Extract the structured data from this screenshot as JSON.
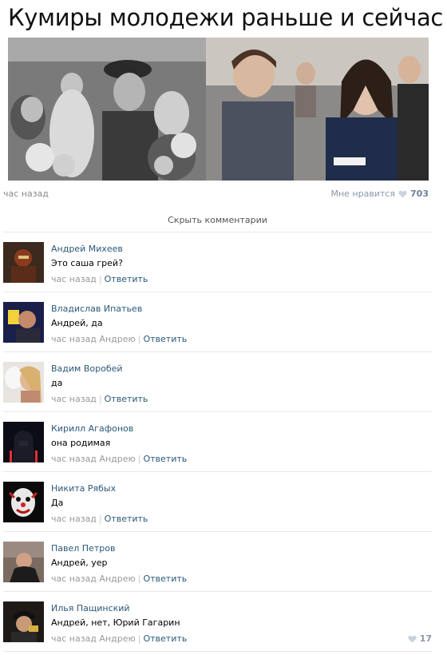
{
  "post": {
    "title": "Кумиры молодежи раньше и сейчас",
    "time": "час назад",
    "like_label": "Мне нравится",
    "like_count": "703"
  },
  "hide_comments_label": "Скрыть комментарии",
  "reply_label": "Ответить",
  "comments": [
    {
      "author": "Андрей Михеев",
      "text": "Это саша грей?",
      "time": "час назад",
      "reply_to": ""
    },
    {
      "author": "Владислав Ипатьев",
      "text": "Андрей, да",
      "time": "час назад",
      "reply_to": "Андрею"
    },
    {
      "author": "Вадим Воробей",
      "text": "да",
      "time": "час назад",
      "reply_to": ""
    },
    {
      "author": "Кирилл Агафонов",
      "text": "она родимая",
      "time": "час назад",
      "reply_to": "Андрею"
    },
    {
      "author": "Никита Рябых",
      "text": "Да",
      "time": "час назад",
      "reply_to": ""
    },
    {
      "author": "Павел Петров",
      "text": "Андрей, уер",
      "time": "час назад",
      "reply_to": "Андрею"
    },
    {
      "author": "Илья Пащинский",
      "text": "Андрей, нет, Юрий Гагарин",
      "time": "час назад",
      "reply_to": "Андрею",
      "likes": "17"
    }
  ],
  "colors": {
    "link": "#2b587a",
    "muted": "#999999",
    "like": "#8a98ab",
    "divider": "#e4e8ed"
  }
}
